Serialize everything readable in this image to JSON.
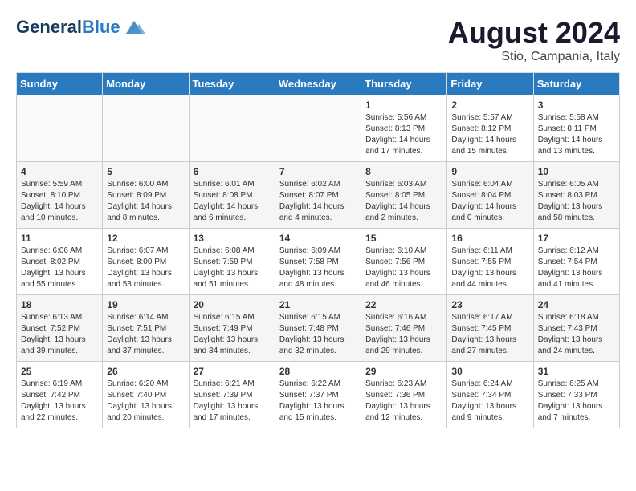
{
  "header": {
    "logo_line1": "General",
    "logo_line2": "Blue",
    "main_title": "August 2024",
    "sub_title": "Stio, Campania, Italy"
  },
  "weekdays": [
    "Sunday",
    "Monday",
    "Tuesday",
    "Wednesday",
    "Thursday",
    "Friday",
    "Saturday"
  ],
  "weeks": [
    [
      {
        "day": "",
        "info": ""
      },
      {
        "day": "",
        "info": ""
      },
      {
        "day": "",
        "info": ""
      },
      {
        "day": "",
        "info": ""
      },
      {
        "day": "1",
        "info": "Sunrise: 5:56 AM\nSunset: 8:13 PM\nDaylight: 14 hours\nand 17 minutes."
      },
      {
        "day": "2",
        "info": "Sunrise: 5:57 AM\nSunset: 8:12 PM\nDaylight: 14 hours\nand 15 minutes."
      },
      {
        "day": "3",
        "info": "Sunrise: 5:58 AM\nSunset: 8:11 PM\nDaylight: 14 hours\nand 13 minutes."
      }
    ],
    [
      {
        "day": "4",
        "info": "Sunrise: 5:59 AM\nSunset: 8:10 PM\nDaylight: 14 hours\nand 10 minutes."
      },
      {
        "day": "5",
        "info": "Sunrise: 6:00 AM\nSunset: 8:09 PM\nDaylight: 14 hours\nand 8 minutes."
      },
      {
        "day": "6",
        "info": "Sunrise: 6:01 AM\nSunset: 8:08 PM\nDaylight: 14 hours\nand 6 minutes."
      },
      {
        "day": "7",
        "info": "Sunrise: 6:02 AM\nSunset: 8:07 PM\nDaylight: 14 hours\nand 4 minutes."
      },
      {
        "day": "8",
        "info": "Sunrise: 6:03 AM\nSunset: 8:05 PM\nDaylight: 14 hours\nand 2 minutes."
      },
      {
        "day": "9",
        "info": "Sunrise: 6:04 AM\nSunset: 8:04 PM\nDaylight: 14 hours\nand 0 minutes."
      },
      {
        "day": "10",
        "info": "Sunrise: 6:05 AM\nSunset: 8:03 PM\nDaylight: 13 hours\nand 58 minutes."
      }
    ],
    [
      {
        "day": "11",
        "info": "Sunrise: 6:06 AM\nSunset: 8:02 PM\nDaylight: 13 hours\nand 55 minutes."
      },
      {
        "day": "12",
        "info": "Sunrise: 6:07 AM\nSunset: 8:00 PM\nDaylight: 13 hours\nand 53 minutes."
      },
      {
        "day": "13",
        "info": "Sunrise: 6:08 AM\nSunset: 7:59 PM\nDaylight: 13 hours\nand 51 minutes."
      },
      {
        "day": "14",
        "info": "Sunrise: 6:09 AM\nSunset: 7:58 PM\nDaylight: 13 hours\nand 48 minutes."
      },
      {
        "day": "15",
        "info": "Sunrise: 6:10 AM\nSunset: 7:56 PM\nDaylight: 13 hours\nand 46 minutes."
      },
      {
        "day": "16",
        "info": "Sunrise: 6:11 AM\nSunset: 7:55 PM\nDaylight: 13 hours\nand 44 minutes."
      },
      {
        "day": "17",
        "info": "Sunrise: 6:12 AM\nSunset: 7:54 PM\nDaylight: 13 hours\nand 41 minutes."
      }
    ],
    [
      {
        "day": "18",
        "info": "Sunrise: 6:13 AM\nSunset: 7:52 PM\nDaylight: 13 hours\nand 39 minutes."
      },
      {
        "day": "19",
        "info": "Sunrise: 6:14 AM\nSunset: 7:51 PM\nDaylight: 13 hours\nand 37 minutes."
      },
      {
        "day": "20",
        "info": "Sunrise: 6:15 AM\nSunset: 7:49 PM\nDaylight: 13 hours\nand 34 minutes."
      },
      {
        "day": "21",
        "info": "Sunrise: 6:15 AM\nSunset: 7:48 PM\nDaylight: 13 hours\nand 32 minutes."
      },
      {
        "day": "22",
        "info": "Sunrise: 6:16 AM\nSunset: 7:46 PM\nDaylight: 13 hours\nand 29 minutes."
      },
      {
        "day": "23",
        "info": "Sunrise: 6:17 AM\nSunset: 7:45 PM\nDaylight: 13 hours\nand 27 minutes."
      },
      {
        "day": "24",
        "info": "Sunrise: 6:18 AM\nSunset: 7:43 PM\nDaylight: 13 hours\nand 24 minutes."
      }
    ],
    [
      {
        "day": "25",
        "info": "Sunrise: 6:19 AM\nSunset: 7:42 PM\nDaylight: 13 hours\nand 22 minutes."
      },
      {
        "day": "26",
        "info": "Sunrise: 6:20 AM\nSunset: 7:40 PM\nDaylight: 13 hours\nand 20 minutes."
      },
      {
        "day": "27",
        "info": "Sunrise: 6:21 AM\nSunset: 7:39 PM\nDaylight: 13 hours\nand 17 minutes."
      },
      {
        "day": "28",
        "info": "Sunrise: 6:22 AM\nSunset: 7:37 PM\nDaylight: 13 hours\nand 15 minutes."
      },
      {
        "day": "29",
        "info": "Sunrise: 6:23 AM\nSunset: 7:36 PM\nDaylight: 13 hours\nand 12 minutes."
      },
      {
        "day": "30",
        "info": "Sunrise: 6:24 AM\nSunset: 7:34 PM\nDaylight: 13 hours\nand 9 minutes."
      },
      {
        "day": "31",
        "info": "Sunrise: 6:25 AM\nSunset: 7:33 PM\nDaylight: 13 hours\nand 7 minutes."
      }
    ]
  ]
}
